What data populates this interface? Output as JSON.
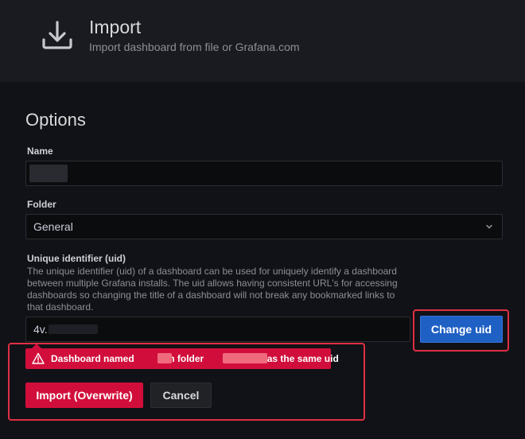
{
  "header": {
    "title": "Import",
    "subtitle": "Import dashboard from file or Grafana.com",
    "icon": "download-icon"
  },
  "options": {
    "title": "Options",
    "name_label": "Name",
    "name_value": "",
    "folder_label": "Folder",
    "folder_value": "General",
    "uid_label": "Unique identifier (uid)",
    "uid_description": "The unique identifier (uid) of a dashboard can be used for uniquely identify a dashboard between multiple Grafana installs. The uid allows having consistent URL's for accessing dashboards so changing the title of a dashboard will not break any bookmarked links to that dashboard.",
    "uid_value": "4v.",
    "change_uid_label": "Change uid"
  },
  "alert": {
    "part1": "Dashboard named",
    "part2": "' in folder",
    "part3": "' has the same uid",
    "icon": "warning-icon"
  },
  "actions": {
    "import_label": "Import (Overwrite)",
    "cancel_label": "Cancel"
  },
  "colors": {
    "primary": "#1f60c4",
    "danger": "#d10e3b",
    "highlight": "#e02f44",
    "background": "#111217"
  }
}
